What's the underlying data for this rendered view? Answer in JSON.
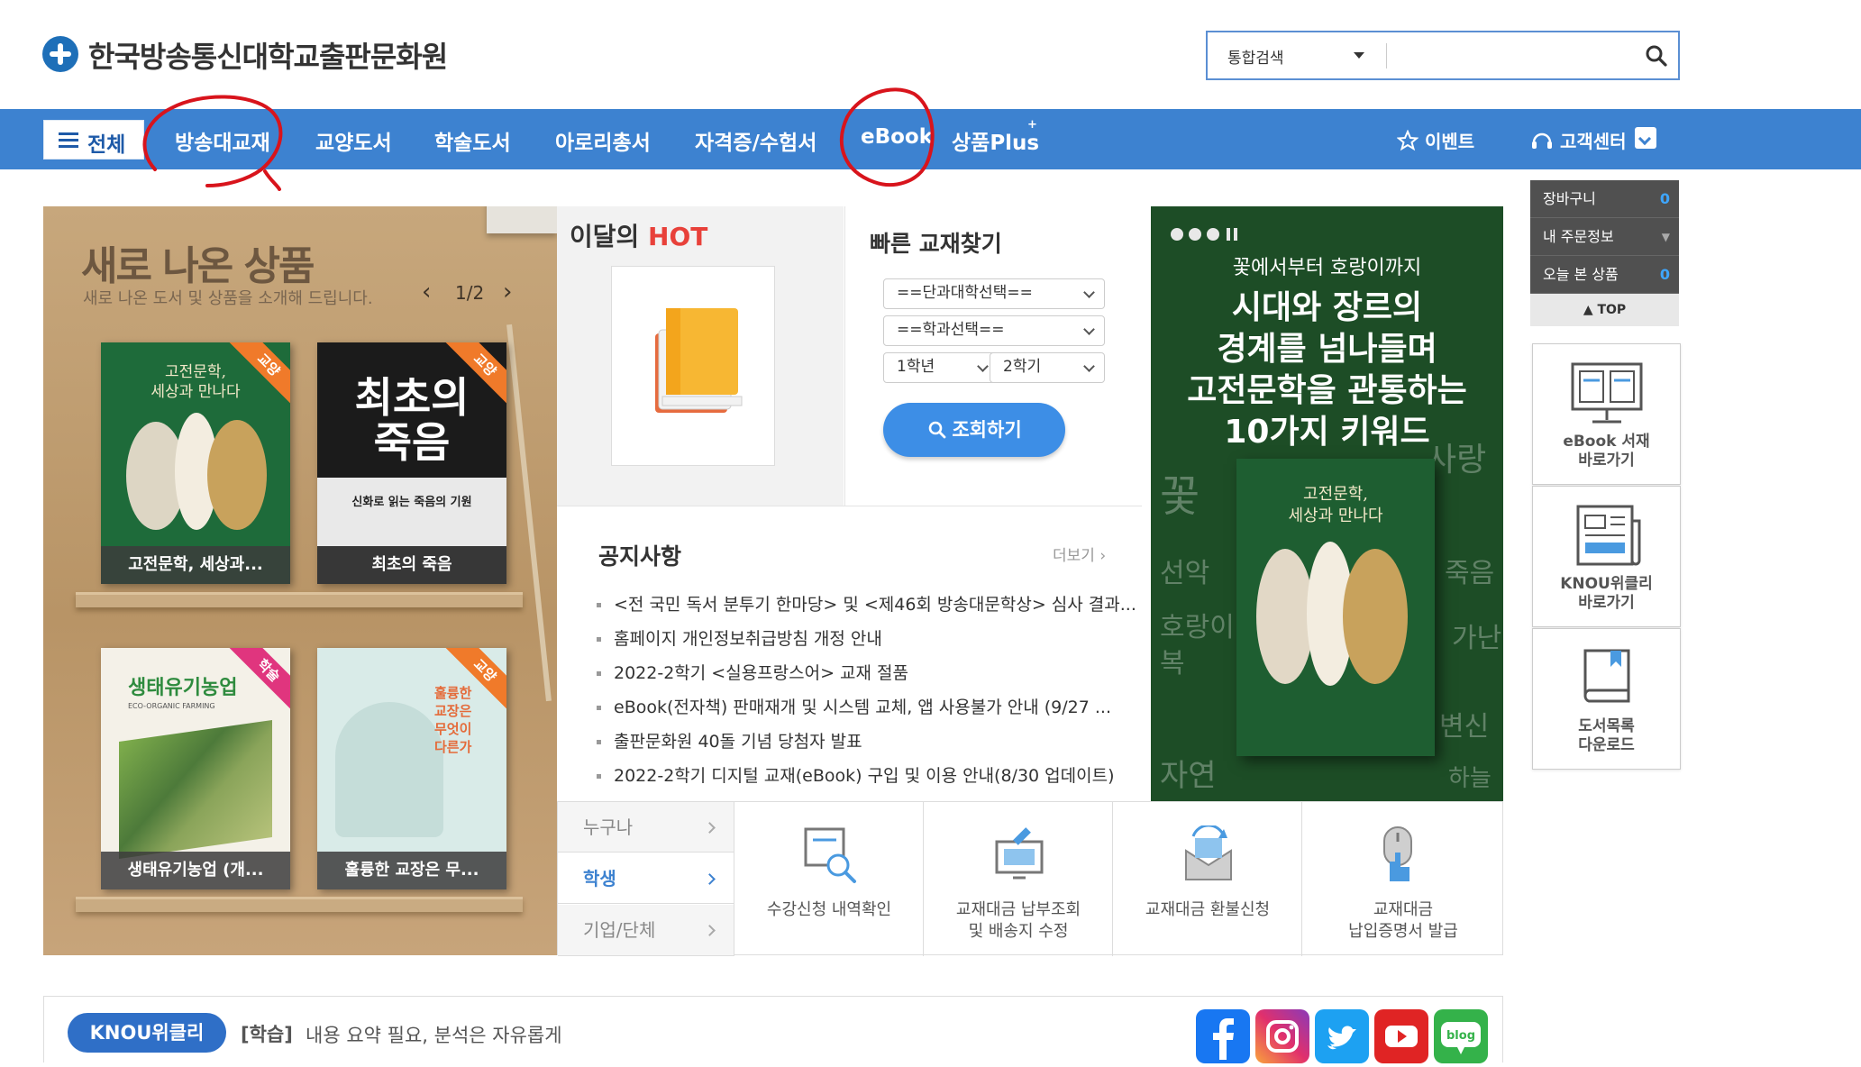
{
  "header": {
    "site_name": "한국방송통신대학교출판문화원",
    "search": {
      "scope": "통합검색",
      "placeholder": ""
    }
  },
  "nav": {
    "all": "전체",
    "items": [
      "방송대교재",
      "교양도서",
      "학술도서",
      "아로리총서",
      "자격증/수험서",
      "eBook",
      "상품Plus"
    ],
    "event": "이벤트",
    "customer_center": "고객센터"
  },
  "new_products": {
    "title": "새로 나온 상품",
    "subtitle": "새로 나온 도서 및 상품을 소개해 드립니다.",
    "page": "1/2",
    "books": [
      {
        "cover_title": "고전문학,\n세상과 만나다",
        "label": "고전문학, 세상과...",
        "ribbon": "교양",
        "ribbon_color": "#f07a2a",
        "cover_color": "#1e6b3a"
      },
      {
        "cover_title": "최초의\n죽음",
        "cover_sub": "신화로 읽는 죽음의 기원",
        "label": "최초의 죽음",
        "ribbon": "교양",
        "ribbon_color": "#f07a2a",
        "cover_color": "#1b1b1b"
      },
      {
        "cover_title": "생태유기농업",
        "cover_sub": "ECO-ORGANIC FARMING",
        "label": "생태유기농업 (개...",
        "ribbon": "학술",
        "ribbon_color": "#e0357e",
        "cover_color": "#f4f1e8"
      },
      {
        "cover_title": "훌륭한 교장은 무엇이 다른가",
        "label": "훌륭한 교장은 무...",
        "ribbon": "교양",
        "ribbon_color": "#f07a2a",
        "cover_color": "#d9ebe8"
      }
    ]
  },
  "hot": {
    "title_prefix": "이달의",
    "title_hot": "HOT"
  },
  "quick_find": {
    "title": "빠른 교재찾기",
    "college": "==단과대학선택==",
    "department": "==학과선택==",
    "grade": "1학년",
    "semester": "2학기",
    "button": "조회하기"
  },
  "notice": {
    "title": "공지사항",
    "more": "더보기",
    "items": [
      "<전 국민 독서 분투기 한마당> 및 <제46회 방송대문학상> 심사 결과...",
      "홈페이지 개인정보취급방침 개정 안내",
      "2022-2학기 <실용프랑스어> 교재 절품",
      "eBook(전자책) 판매재개 및 시스템 교체, 앱 사용불가 안내 (9/27 ...",
      "출판문화원 40돌 기념 당첨자 발표",
      "2022-2학기 디지털 교재(eBook) 구입 및 이용 안내(8/30 업데이트)"
    ]
  },
  "promo": {
    "line1": "꽃에서부터 호랑이까지",
    "line2": "시대와 장르의",
    "line3": "경계를 넘나들며",
    "line4": "고전문학을 관통하는",
    "line5": "10가지 키워드",
    "words_left": [
      "꽃",
      "선악",
      "호랑이",
      "복",
      "자연"
    ],
    "words_right": [
      "사랑",
      "죽음",
      "가난",
      "변신",
      "하늘"
    ],
    "book_title": "고전문학,\n세상과 만나다"
  },
  "quick_menu": {
    "tabs": [
      "누구나",
      "학생",
      "기업/단체"
    ],
    "active_tab": "학생",
    "cells": [
      "수강신청 내역확인",
      "교재대금 납부조회\n및 배송지 수정",
      "교재대금 환불신청",
      "교재대금\n납입증명서 발급"
    ]
  },
  "side": {
    "cart": "장바구니",
    "cart_count": "0",
    "order": "내 주문정보",
    "viewed": "오늘 본 상품",
    "viewed_count": "0",
    "top": "TOP",
    "cards": [
      "eBook 서재\n바로가기",
      "KNOU위클리\n바로가기",
      "도서목록\n다운로드"
    ]
  },
  "weekly": {
    "badge": "KNOU위클리",
    "category": "[학습]",
    "text": "내용 요약 필요, 분석은 자유롭게"
  },
  "sns": [
    "facebook-icon",
    "instagram-icon",
    "twitter-icon",
    "youtube-icon",
    "blog-icon"
  ],
  "colors": {
    "nav": "#3d82d0",
    "accent_red": "#e8413a",
    "button_blue": "#3d8ee6",
    "annotation": "#d8141c"
  }
}
